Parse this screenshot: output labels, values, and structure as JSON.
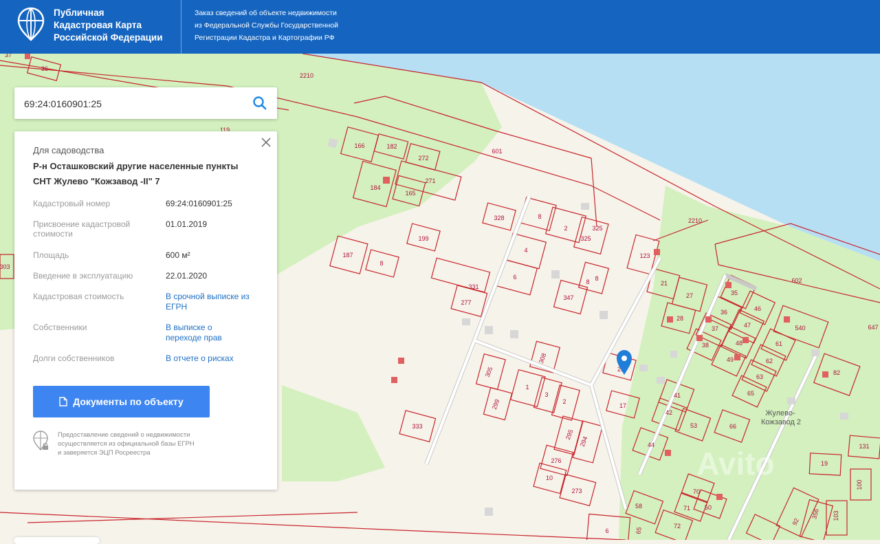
{
  "header": {
    "brand_lines": [
      "Публичная",
      "Кадастровая Карта",
      "Российской Федерации"
    ],
    "subtitle_lines": [
      "Заказ сведений об объекте недвижимости",
      "из Федеральной Службы Государственной",
      "Регистрации Кадастра и Картографии РФ"
    ],
    "logo_icon": "globe-icon"
  },
  "search": {
    "value": "69:24:0160901:25",
    "icon": "search-icon"
  },
  "card": {
    "category": "Для садоводства",
    "address_line1": "Р-н Осташковский другие населенные пункты",
    "address_line2": "СНТ Жулево \"Кожзавод -II\" 7",
    "close_icon": "close-icon",
    "fields": [
      {
        "label": "Кадастровый номер",
        "value": "69:24:0160901:25"
      },
      {
        "label": "Присвоение кадастровой стоимости",
        "value": "01.01.2019"
      },
      {
        "label": "Площадь",
        "value": "600 м²"
      },
      {
        "label": "Введение в эксплуатацию",
        "value": "22.01.2020"
      },
      {
        "label": "Кадастровая стоимость",
        "value": "В срочной выписке из ЕГРН"
      },
      {
        "label": "Собственники",
        "value": "В выписке о переходе прав"
      },
      {
        "label": "Долги собственников",
        "value": "В отчете о рисках"
      }
    ],
    "button_label": "Документы по объекту",
    "button_icon": "document-icon",
    "note_lines": [
      "Предоставление сведений о недвижимости",
      "осуществляется из официальной базы ЕГРН",
      "и заверяется ЭЦП Росреестра"
    ],
    "note_icon": "secure-globe-icon"
  },
  "map": {
    "colors": {
      "water": "#b6dff4",
      "forest": "#d3f0be",
      "land": "#f6f3ea",
      "boundary": "#c8242b",
      "marker": "#1f7ed8"
    },
    "place_label_lines": [
      "Жулево-",
      "Кожзавод 2"
    ],
    "watermark": "Avito",
    "marker_icon": "location-pin-icon",
    "parcel_labels": [
      "37",
      "36",
      "2210",
      "119",
      "166",
      "182",
      "272",
      "271",
      "184",
      "165",
      "601",
      "328",
      "8",
      "2",
      "325",
      "325",
      "199",
      "187",
      "8",
      "4",
      "6",
      "331",
      "277",
      "347",
      "8",
      "8",
      "123",
      "21",
      "27",
      "35",
      "28",
      "36",
      "46",
      "37",
      "47",
      "540",
      "38",
      "48",
      "49",
      "61",
      "647",
      "602",
      "2210",
      "303",
      "308",
      "305",
      "299",
      "1",
      "3",
      "2",
      "25",
      "17",
      "41",
      "62",
      "63",
      "65",
      "42",
      "53",
      "66",
      "82",
      "295",
      "294",
      "333",
      "276",
      "10",
      "273",
      "44",
      "131",
      "19",
      "100",
      "70",
      "71",
      "50",
      "58",
      "72",
      "6",
      "65",
      "92",
      "356",
      "103"
    ]
  }
}
